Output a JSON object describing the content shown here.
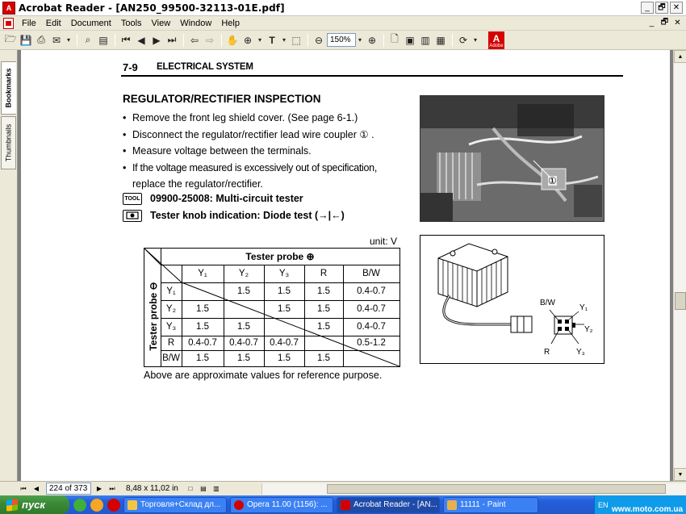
{
  "window": {
    "title": "Acrobat Reader - [AN250_99500-32113-01E.pdf]",
    "controls": [
      "_",
      "🗗",
      "✕"
    ]
  },
  "menu": {
    "items": [
      "File",
      "Edit",
      "Document",
      "Tools",
      "View",
      "Window",
      "Help"
    ],
    "mdi_controls": [
      "_",
      "🗗",
      "✕"
    ]
  },
  "toolbar": {
    "zoom": "150%"
  },
  "nav_tabs": [
    "Bookmarks",
    "Thumbnails"
  ],
  "page": {
    "section_no": "7-9",
    "section_title": "ELECTRICAL SYSTEM",
    "heading": "REGULATOR/RECTIFIER INSPECTION",
    "bullets": [
      "Remove the front leg shield cover. (See page 6-1.)",
      "Disconnect the regulator/rectifier lead wire coupler ① .",
      "Measure voltage between the terminals."
    ],
    "bullet4_line1": "If the voltage measured is excessively out of specification,",
    "bullet4_line2": "replace the regulator/rectifier.",
    "tool1_icon": "TOOL",
    "tool1": "09900-25008: Multi-circuit tester",
    "tool2": "Tester knob indication: Diode test (→|←)",
    "unit": "unit: V",
    "table": {
      "probe_plus": "Tester  probe ⊕",
      "probe_minus": "Tester  probe ⊖",
      "cols": [
        "Y₁",
        "Y₂",
        "Y₃",
        "R",
        "B/W"
      ],
      "rows": [
        {
          "label": "Y₁",
          "cells": [
            "",
            "1.5",
            "1.5",
            "1.5",
            "0.4-0.7"
          ]
        },
        {
          "label": "Y₂",
          "cells": [
            "1.5",
            "",
            "1.5",
            "1.5",
            "0.4-0.7"
          ]
        },
        {
          "label": "Y₃",
          "cells": [
            "1.5",
            "1.5",
            "",
            "1.5",
            "0.4-0.7"
          ]
        },
        {
          "label": "R",
          "cells": [
            "0.4-0.7",
            "0.4-0.7",
            "0.4-0.7",
            "",
            "0.5-1.2"
          ]
        },
        {
          "label": "B/W",
          "cells": [
            "1.5",
            "1.5",
            "1.5",
            "1.5",
            ""
          ]
        }
      ]
    },
    "caption": "Above are approximate values for reference purpose.",
    "photo_callout": "①",
    "diagram_labels": [
      "B/W",
      "Y₁",
      "Y₂",
      "R",
      "Y₃"
    ]
  },
  "statusbar": {
    "page_field": "224 of 373",
    "page_size": "8,48 x 11,02 in"
  },
  "taskbar": {
    "start_label": "пуск",
    "tasks": [
      {
        "label": "Торговля+Склад дл...",
        "color": "#f4c542",
        "active": false
      },
      {
        "label": "Opera 11.00 (1156): ...",
        "color": "#d40000",
        "active": false
      },
      {
        "label": "Acrobat Reader - [AN...",
        "color": "#d40000",
        "active": true
      },
      {
        "label": "11111 - Paint",
        "color": "#e8b04a",
        "active": false
      }
    ],
    "tray_lang": "EN",
    "watermark": "www.moto.com.ua"
  }
}
